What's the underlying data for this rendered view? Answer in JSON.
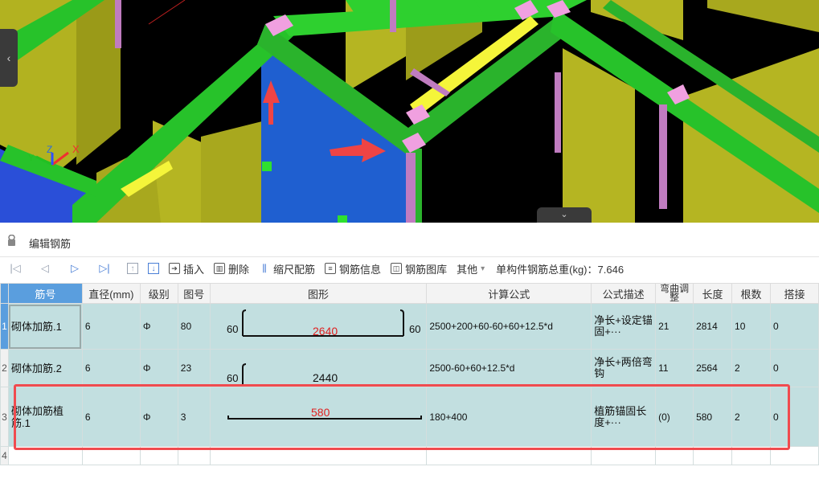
{
  "panel": {
    "title": "编辑钢筋"
  },
  "toolbar": {
    "insert": "插入",
    "delete": "删除",
    "scale_rebar": "缩尺配筋",
    "rebar_info": "钢筋信息",
    "rebar_library": "钢筋图库",
    "other": "其他",
    "other_arrow": "▾",
    "total_weight": "单构件钢筋总重(kg)：7.646"
  },
  "table": {
    "headers": {
      "no": "筋号",
      "diameter": "直径(mm)",
      "grade": "级别",
      "fig_no": "图号",
      "shape": "图形",
      "formula": "计算公式",
      "formula_desc": "公式描述",
      "bend_adjust": "弯曲调整",
      "length": "长度",
      "count": "根数",
      "splice": "搭接"
    },
    "rows": [
      {
        "rownum": "1",
        "name": "砌体加筋.1",
        "diameter": "6",
        "grade": "Φ",
        "fig_no": "80",
        "shape_left": "60",
        "shape_mid": "2640",
        "shape_right": "60",
        "formula": "2500+200+60-60+60+12.5*d",
        "desc": "净长+设定锚固+···",
        "bend": "21",
        "length": "2814",
        "count": "10",
        "splice": "0"
      },
      {
        "rownum": "2",
        "name": "砌体加筋.2",
        "diameter": "6",
        "grade": "Φ",
        "fig_no": "23",
        "shape_left": "60",
        "shape_mid": "2440",
        "formula": "2500-60+60+12.5*d",
        "desc": "净长+两倍弯钩",
        "bend": "11",
        "length": "2564",
        "count": "2",
        "splice": "0"
      },
      {
        "rownum": "3",
        "name": "砌体加筋植筋.1",
        "diameter": "6",
        "grade": "Φ",
        "fig_no": "3",
        "shape_mid": "580",
        "formula": "180+400",
        "desc": "植筋锚固长度+···",
        "bend": "(0)",
        "length": "580",
        "count": "2",
        "splice": "0"
      },
      {
        "rownum": "4"
      }
    ]
  },
  "colors": {
    "highlight": "#f04b4f",
    "row_bg": "#c2dfe0",
    "selected": "#5a9ede",
    "shape_red_text": "#e02020"
  }
}
